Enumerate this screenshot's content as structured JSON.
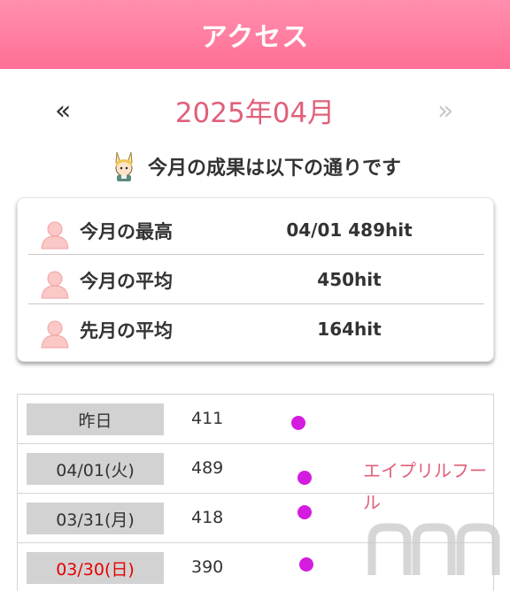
{
  "header": {
    "title": "アクセス"
  },
  "month_nav": {
    "prev": "«",
    "month": "2025年04月",
    "next": "»"
  },
  "summary": {
    "text": "今月の成果は以下の通りです",
    "icon": "bunny-icon"
  },
  "stats": [
    {
      "label": "今月の最高",
      "value": "04/01 489hit"
    },
    {
      "label": "今月の平均",
      "value": "450hit"
    },
    {
      "label": "先月の平均",
      "value": "164hit"
    }
  ],
  "daily": [
    {
      "label": "昨日",
      "hits": "411",
      "holiday": false,
      "note": ""
    },
    {
      "label": "04/01(火)",
      "hits": "489",
      "holiday": false,
      "note": "エイプリルフール"
    },
    {
      "label": "03/31(月)",
      "hits": "418",
      "holiday": false,
      "note": ""
    },
    {
      "label": "03/30(日)",
      "hits": "390",
      "holiday": true,
      "note": ""
    }
  ],
  "colors": {
    "header": "#ff7a9c",
    "accent": "#e0607a",
    "dot": "#d41ce0",
    "holiday": "#e60000"
  },
  "watermark": {
    "text": "nmn"
  }
}
